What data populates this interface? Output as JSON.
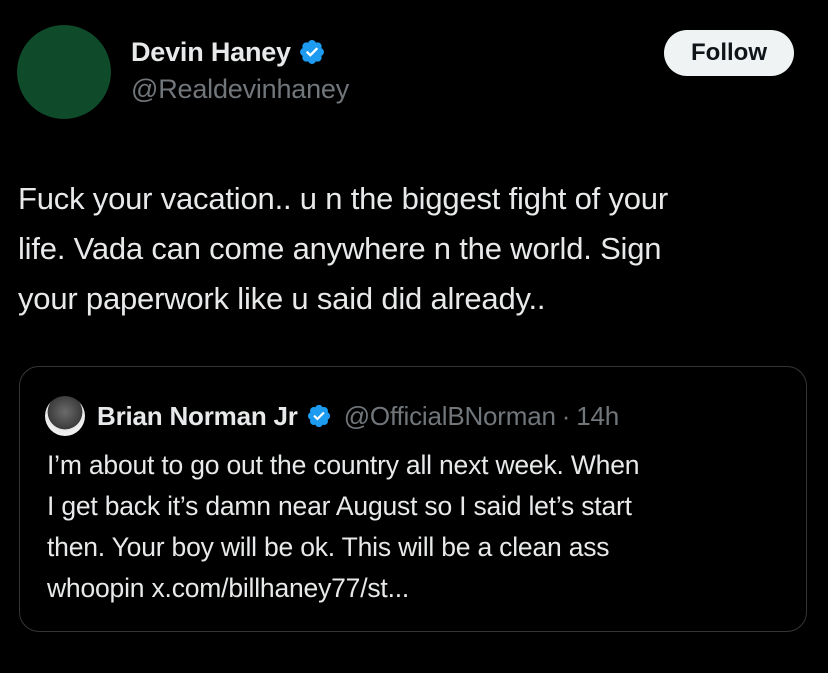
{
  "author": {
    "display_name": "Devin Haney",
    "handle": "@Realdevinhaney",
    "verified_icon": "verified-badge-icon",
    "avatar_color": "#0f4a2a"
  },
  "follow_button": {
    "label": "Follow"
  },
  "tweet": {
    "text": "Fuck your vacation.. u n the biggest fight of your\nlife. Vada can come anywhere n the world. Sign\nyour paperwork like u said did already.."
  },
  "quoted_tweet": {
    "display_name": "Brian Norman Jr",
    "handle": "@OfficialBNorman",
    "separator": "·",
    "time": "14h",
    "text": "I’m about to go out the country all next week. When\nI get back it’s damn near August so I said let’s start\nthen. Your boy will be ok. This will be a clean ass\nwhoopin x.com/billhaney77/st..."
  },
  "colors": {
    "background": "#000000",
    "primary_text": "#e7e9ea",
    "secondary_text": "#71767b",
    "verified_blue": "#1d9bf0",
    "border": "#333639",
    "follow_bg": "#eff3f4"
  }
}
